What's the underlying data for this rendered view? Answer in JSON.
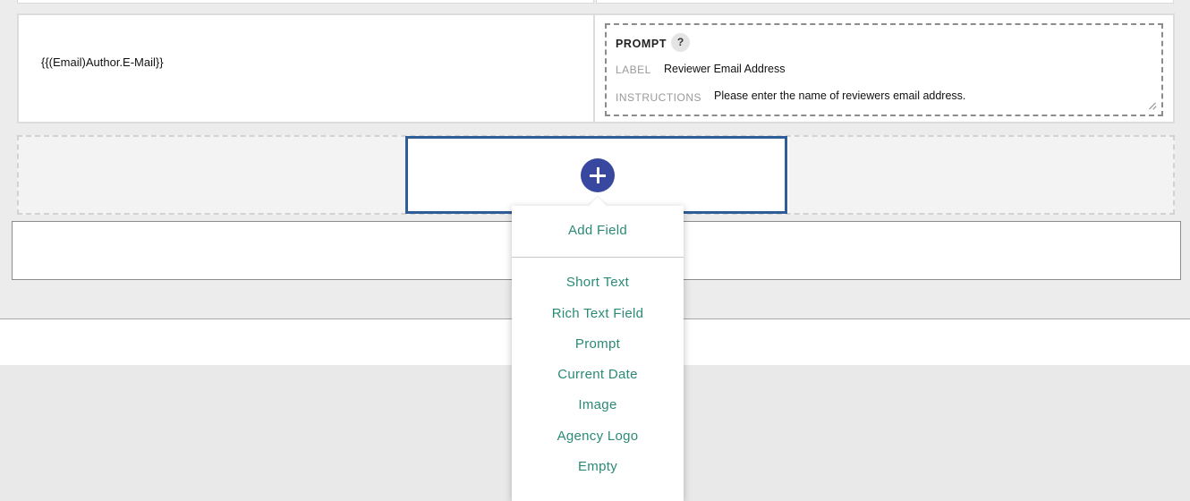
{
  "row": {
    "expression": "{{(Email)Author.E-Mail}}",
    "prompt": {
      "title": "PROMPT",
      "help": "?",
      "label_caption": "LABEL",
      "label_value": "Reviewer Email Address",
      "instructions_caption": "INSTRUCTIONS",
      "instructions_value": "Please enter the name of reviewers email address."
    }
  },
  "add_menu": {
    "header": "Add Field",
    "items": [
      "Short Text",
      "Rich Text Field",
      "Prompt",
      "Current Date",
      "Image",
      "Agency Logo",
      "Empty"
    ]
  },
  "colors": {
    "accent_button": "#3848a0",
    "drop_target_border": "#2f5d97",
    "menu_text": "#2a8a75"
  }
}
